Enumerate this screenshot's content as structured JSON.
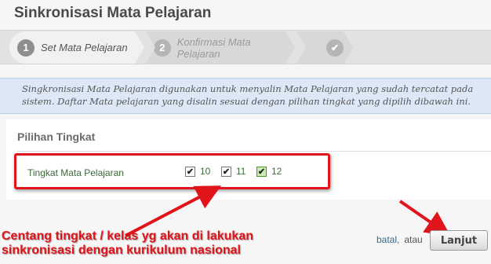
{
  "page": {
    "title": "Sinkronisasi Mata Pelajaran"
  },
  "wizard": {
    "steps": [
      {
        "number": "1",
        "label": "Set Mata Pelajaran"
      },
      {
        "number": "2",
        "label": "Konfirmasi Mata Pelajaran"
      },
      {
        "number": "",
        "label": "",
        "icon": "check-icon"
      }
    ]
  },
  "info": {
    "text": "Singkronisasi Mata Pelajaran digunakan untuk menyalin Mata Pelajaran yang sudah tercatat pada sistem. Daftar Mata pelajaran yang disalin sesuai dengan pilihan tingkat yang dipilih dibawah ini."
  },
  "section": {
    "title": "Pilihan Tingkat",
    "row_label": "Tingkat Mata Pelajaran",
    "options": [
      {
        "label": "10",
        "checked": true
      },
      {
        "label": "11",
        "checked": true
      },
      {
        "label": "12",
        "checked": true
      }
    ]
  },
  "annotation": {
    "line1": "Centang tingkat / kelas yg akan di lakukan",
    "line2": "sinkronisasi dengan kurikulum nasional",
    "color": "#e0141b"
  },
  "actions": {
    "cancel": "batal,",
    "or": "atau",
    "next": "Lanjut"
  }
}
